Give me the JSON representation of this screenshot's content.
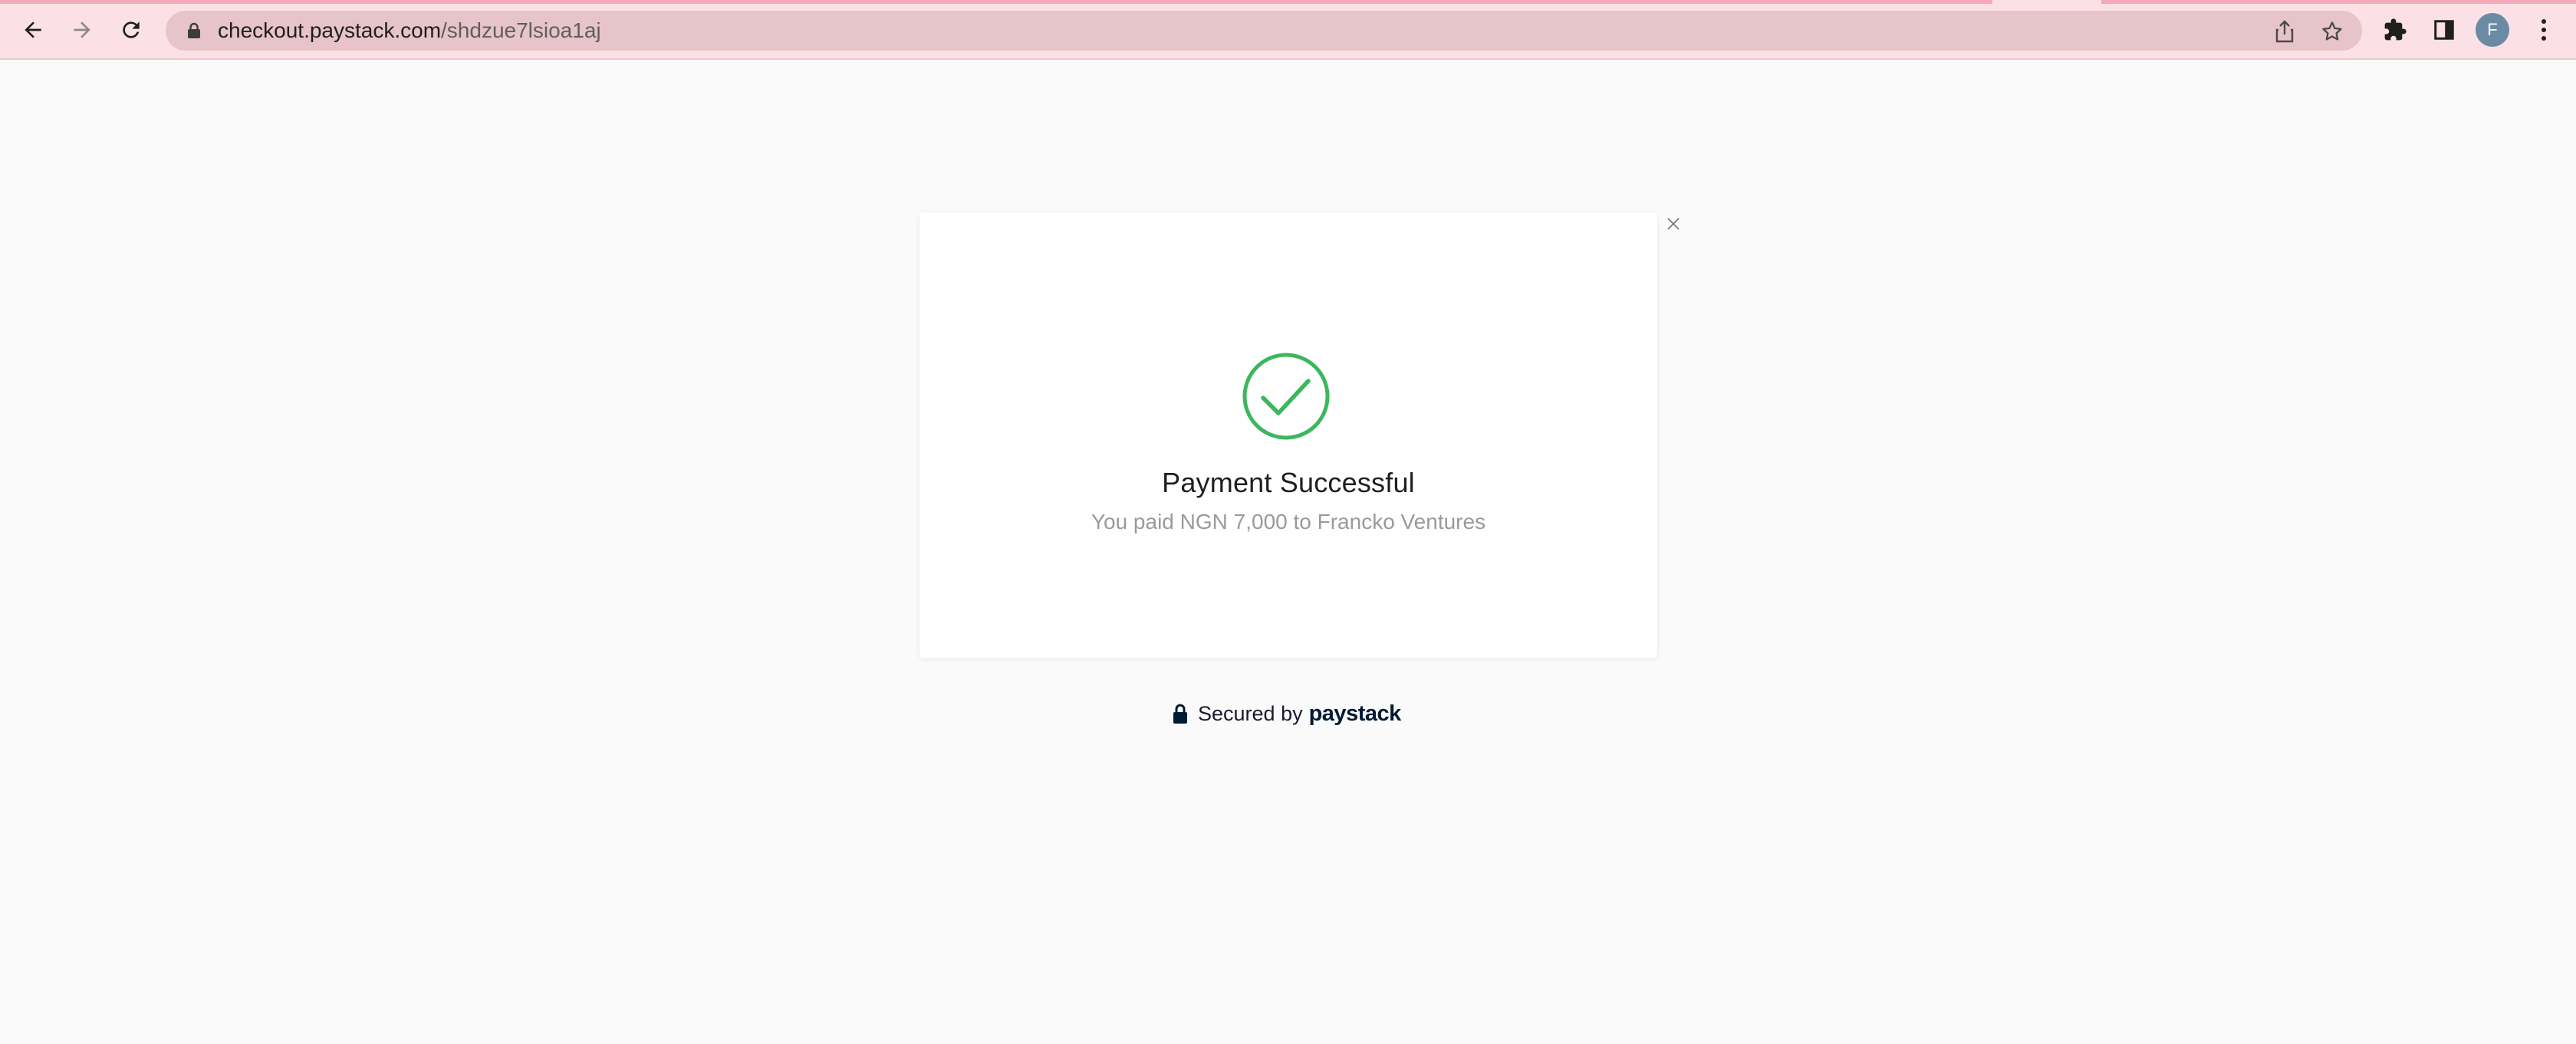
{
  "browser": {
    "url_domain": "checkout.paystack.com",
    "url_path": "/shdzue7lsioa1aj",
    "avatar_letter": "F",
    "icons": [
      "back-arrow-icon",
      "forward-arrow-icon",
      "reload-icon",
      "lock-icon",
      "share-icon",
      "star-icon",
      "extensions-icon",
      "side-panel-icon",
      "kebab-menu-icon"
    ]
  },
  "modal": {
    "title": "Payment Successful",
    "message": "You paid NGN 7,000 to Francko Ventures",
    "success_color": "#3bb75e"
  },
  "footer": {
    "secured_label": "Secured by",
    "brand": "paystack"
  }
}
